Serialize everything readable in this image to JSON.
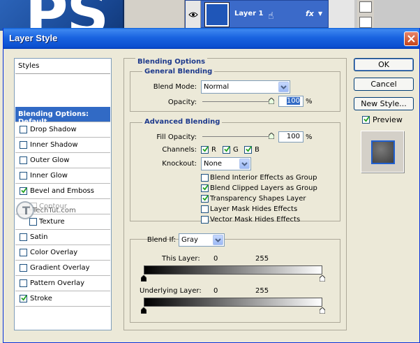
{
  "background": {
    "logo_text": "PS",
    "layer_name": "Layer 1",
    "fx_label": "fx"
  },
  "dialog": {
    "title": "Layer Style",
    "buttons": {
      "ok": "OK",
      "cancel": "Cancel",
      "new_style": "New Style..."
    },
    "preview": {
      "label": "Preview",
      "checked": true
    }
  },
  "styles": {
    "header": "Styles",
    "items": [
      {
        "label": "Blending Options: Default",
        "selected": true
      },
      {
        "label": "Drop Shadow",
        "checked": false
      },
      {
        "label": "Inner Shadow",
        "checked": false
      },
      {
        "label": "Outer Glow",
        "checked": false
      },
      {
        "label": "Inner Glow",
        "checked": false
      },
      {
        "label": "Bevel and Emboss",
        "checked": true
      },
      {
        "label": "Contour",
        "checked": false
      },
      {
        "label": "Texture",
        "checked": false
      },
      {
        "label": "Satin",
        "checked": false
      },
      {
        "label": "Color Overlay",
        "checked": false
      },
      {
        "label": "Gradient Overlay",
        "checked": false
      },
      {
        "label": "Pattern Overlay",
        "checked": false
      },
      {
        "label": "Stroke",
        "checked": true
      }
    ]
  },
  "watermark": "TechTut.com",
  "blending": {
    "section_title": "Blending Options",
    "general": {
      "title": "General Blending",
      "blend_mode_label": "Blend Mode:",
      "blend_mode_value": "Normal",
      "opacity_label": "Opacity:",
      "opacity_value": "100",
      "percent": "%"
    },
    "advanced": {
      "title": "Advanced Blending",
      "fill_opacity_label": "Fill Opacity:",
      "fill_opacity_value": "100",
      "percent": "%",
      "channels_label": "Channels:",
      "channels": [
        {
          "label": "R",
          "checked": true
        },
        {
          "label": "G",
          "checked": true
        },
        {
          "label": "B",
          "checked": true
        }
      ],
      "knockout_label": "Knockout:",
      "knockout_value": "None",
      "options": [
        {
          "label": "Blend Interior Effects as Group",
          "checked": false
        },
        {
          "label": "Blend Clipped Layers as Group",
          "checked": true
        },
        {
          "label": "Transparency Shapes Layer",
          "checked": true
        },
        {
          "label": "Layer Mask Hides Effects",
          "checked": false
        },
        {
          "label": "Vector Mask Hides Effects",
          "checked": false
        }
      ]
    },
    "blend_if": {
      "label": "Blend If:",
      "value": "Gray",
      "this_layer_label": "This Layer:",
      "this_layer_min": "0",
      "this_layer_max": "255",
      "underlying_label": "Underlying Layer:",
      "underlying_min": "0",
      "underlying_max": "255"
    }
  },
  "colors": {
    "titlebar": "#0b4fd0",
    "selection": "#316ac5",
    "group_title": "#1e3a8c",
    "close": "#c4441b"
  }
}
